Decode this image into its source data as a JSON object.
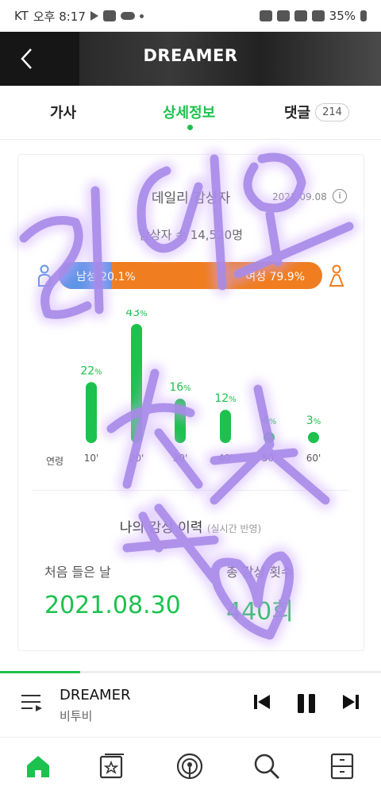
{
  "status": {
    "carrier": "KT",
    "time": "오후 8:17",
    "battery": "35%"
  },
  "header": {
    "title": "DREAMER"
  },
  "tabs": {
    "lyrics": "가사",
    "detail": "상세정보",
    "comments": "댓글",
    "comment_count": "214"
  },
  "stats": {
    "daily_title": "데일리 감상자",
    "date": "2021.09.08",
    "listeners": "감상자 수 14,520명",
    "male_label": "남성 20.1%",
    "female_label": "여성 79.9%",
    "male_ratio": 0.201,
    "colors": {
      "male": "#5f95e6",
      "female": "#f07d1f",
      "accent": "#1cc24d"
    }
  },
  "chart_data": {
    "type": "bar",
    "xlabel": "연령",
    "categories": [
      "10'",
      "20'",
      "30'",
      "40'",
      "50'",
      "60'"
    ],
    "values": [
      22,
      43,
      16,
      12,
      4,
      3
    ],
    "unit": "%"
  },
  "history": {
    "title": "나의 감상 이력",
    "note": "(실시간 반영)",
    "first_label": "처음 들은 날",
    "first_value": "2021.08.30",
    "count_label": "총 감상 횟수",
    "count_value": "440회"
  },
  "player": {
    "title": "DREAMER",
    "artist": "비투비",
    "progress": 0.21
  },
  "overlay": {
    "line1": "라디오",
    "line2": "숫자",
    "line3": "조작"
  }
}
